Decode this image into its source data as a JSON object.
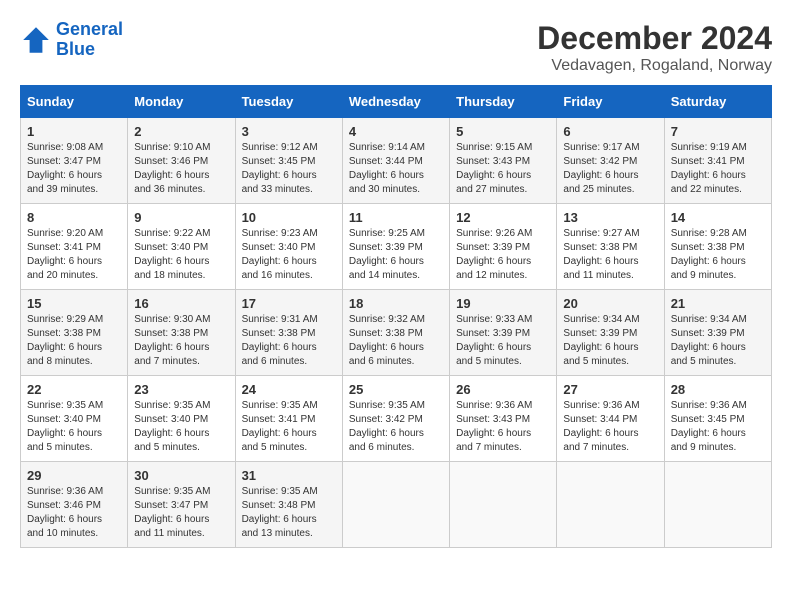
{
  "logo": {
    "line1": "General",
    "line2": "Blue"
  },
  "title": "December 2024",
  "location": "Vedavagen, Rogaland, Norway",
  "days_of_week": [
    "Sunday",
    "Monday",
    "Tuesday",
    "Wednesday",
    "Thursday",
    "Friday",
    "Saturday"
  ],
  "weeks": [
    [
      {
        "day": "1",
        "sunrise": "Sunrise: 9:08 AM",
        "sunset": "Sunset: 3:47 PM",
        "daylight": "Daylight: 6 hours and 39 minutes."
      },
      {
        "day": "2",
        "sunrise": "Sunrise: 9:10 AM",
        "sunset": "Sunset: 3:46 PM",
        "daylight": "Daylight: 6 hours and 36 minutes."
      },
      {
        "day": "3",
        "sunrise": "Sunrise: 9:12 AM",
        "sunset": "Sunset: 3:45 PM",
        "daylight": "Daylight: 6 hours and 33 minutes."
      },
      {
        "day": "4",
        "sunrise": "Sunrise: 9:14 AM",
        "sunset": "Sunset: 3:44 PM",
        "daylight": "Daylight: 6 hours and 30 minutes."
      },
      {
        "day": "5",
        "sunrise": "Sunrise: 9:15 AM",
        "sunset": "Sunset: 3:43 PM",
        "daylight": "Daylight: 6 hours and 27 minutes."
      },
      {
        "day": "6",
        "sunrise": "Sunrise: 9:17 AM",
        "sunset": "Sunset: 3:42 PM",
        "daylight": "Daylight: 6 hours and 25 minutes."
      },
      {
        "day": "7",
        "sunrise": "Sunrise: 9:19 AM",
        "sunset": "Sunset: 3:41 PM",
        "daylight": "Daylight: 6 hours and 22 minutes."
      }
    ],
    [
      {
        "day": "8",
        "sunrise": "Sunrise: 9:20 AM",
        "sunset": "Sunset: 3:41 PM",
        "daylight": "Daylight: 6 hours and 20 minutes."
      },
      {
        "day": "9",
        "sunrise": "Sunrise: 9:22 AM",
        "sunset": "Sunset: 3:40 PM",
        "daylight": "Daylight: 6 hours and 18 minutes."
      },
      {
        "day": "10",
        "sunrise": "Sunrise: 9:23 AM",
        "sunset": "Sunset: 3:40 PM",
        "daylight": "Daylight: 6 hours and 16 minutes."
      },
      {
        "day": "11",
        "sunrise": "Sunrise: 9:25 AM",
        "sunset": "Sunset: 3:39 PM",
        "daylight": "Daylight: 6 hours and 14 minutes."
      },
      {
        "day": "12",
        "sunrise": "Sunrise: 9:26 AM",
        "sunset": "Sunset: 3:39 PM",
        "daylight": "Daylight: 6 hours and 12 minutes."
      },
      {
        "day": "13",
        "sunrise": "Sunrise: 9:27 AM",
        "sunset": "Sunset: 3:38 PM",
        "daylight": "Daylight: 6 hours and 11 minutes."
      },
      {
        "day": "14",
        "sunrise": "Sunrise: 9:28 AM",
        "sunset": "Sunset: 3:38 PM",
        "daylight": "Daylight: 6 hours and 9 minutes."
      }
    ],
    [
      {
        "day": "15",
        "sunrise": "Sunrise: 9:29 AM",
        "sunset": "Sunset: 3:38 PM",
        "daylight": "Daylight: 6 hours and 8 minutes."
      },
      {
        "day": "16",
        "sunrise": "Sunrise: 9:30 AM",
        "sunset": "Sunset: 3:38 PM",
        "daylight": "Daylight: 6 hours and 7 minutes."
      },
      {
        "day": "17",
        "sunrise": "Sunrise: 9:31 AM",
        "sunset": "Sunset: 3:38 PM",
        "daylight": "Daylight: 6 hours and 6 minutes."
      },
      {
        "day": "18",
        "sunrise": "Sunrise: 9:32 AM",
        "sunset": "Sunset: 3:38 PM",
        "daylight": "Daylight: 6 hours and 6 minutes."
      },
      {
        "day": "19",
        "sunrise": "Sunrise: 9:33 AM",
        "sunset": "Sunset: 3:39 PM",
        "daylight": "Daylight: 6 hours and 5 minutes."
      },
      {
        "day": "20",
        "sunrise": "Sunrise: 9:34 AM",
        "sunset": "Sunset: 3:39 PM",
        "daylight": "Daylight: 6 hours and 5 minutes."
      },
      {
        "day": "21",
        "sunrise": "Sunrise: 9:34 AM",
        "sunset": "Sunset: 3:39 PM",
        "daylight": "Daylight: 6 hours and 5 minutes."
      }
    ],
    [
      {
        "day": "22",
        "sunrise": "Sunrise: 9:35 AM",
        "sunset": "Sunset: 3:40 PM",
        "daylight": "Daylight: 6 hours and 5 minutes."
      },
      {
        "day": "23",
        "sunrise": "Sunrise: 9:35 AM",
        "sunset": "Sunset: 3:40 PM",
        "daylight": "Daylight: 6 hours and 5 minutes."
      },
      {
        "day": "24",
        "sunrise": "Sunrise: 9:35 AM",
        "sunset": "Sunset: 3:41 PM",
        "daylight": "Daylight: 6 hours and 5 minutes."
      },
      {
        "day": "25",
        "sunrise": "Sunrise: 9:35 AM",
        "sunset": "Sunset: 3:42 PM",
        "daylight": "Daylight: 6 hours and 6 minutes."
      },
      {
        "day": "26",
        "sunrise": "Sunrise: 9:36 AM",
        "sunset": "Sunset: 3:43 PM",
        "daylight": "Daylight: 6 hours and 7 minutes."
      },
      {
        "day": "27",
        "sunrise": "Sunrise: 9:36 AM",
        "sunset": "Sunset: 3:44 PM",
        "daylight": "Daylight: 6 hours and 7 minutes."
      },
      {
        "day": "28",
        "sunrise": "Sunrise: 9:36 AM",
        "sunset": "Sunset: 3:45 PM",
        "daylight": "Daylight: 6 hours and 9 minutes."
      }
    ],
    [
      {
        "day": "29",
        "sunrise": "Sunrise: 9:36 AM",
        "sunset": "Sunset: 3:46 PM",
        "daylight": "Daylight: 6 hours and 10 minutes."
      },
      {
        "day": "30",
        "sunrise": "Sunrise: 9:35 AM",
        "sunset": "Sunset: 3:47 PM",
        "daylight": "Daylight: 6 hours and 11 minutes."
      },
      {
        "day": "31",
        "sunrise": "Sunrise: 9:35 AM",
        "sunset": "Sunset: 3:48 PM",
        "daylight": "Daylight: 6 hours and 13 minutes."
      },
      null,
      null,
      null,
      null
    ]
  ]
}
